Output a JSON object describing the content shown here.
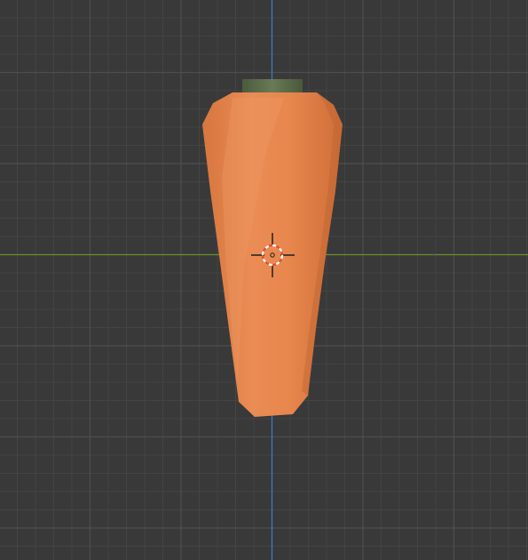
{
  "viewport": {
    "background_color": "#393939",
    "grid_minor_color": "#444444",
    "grid_major_color": "#4e4e4e",
    "x_axis_color": "#6b8e23",
    "z_axis_color": "#3d7bc8"
  },
  "object": {
    "body_color": "#e6844a",
    "body_shadow_color": "#c96e3a",
    "body_highlight_color": "#ee9a66",
    "cap_color": "#5b6a4a"
  },
  "cursor": {
    "icon": "3d-cursor-icon",
    "ring_color_a": "#e34a3a",
    "ring_color_b": "#ffffff",
    "crosshair_color": "#1f1f1f"
  }
}
